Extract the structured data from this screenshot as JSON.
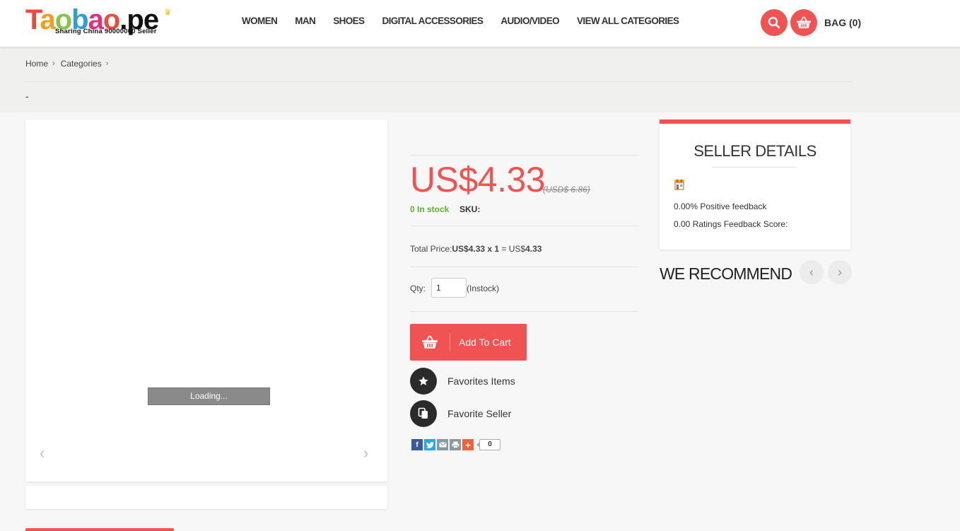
{
  "brand": {
    "logo_main": [
      "T",
      "a",
      "o",
      "b",
      "a",
      "o",
      ".pe"
    ],
    "logo_tagline": "Sharing China 90000000 Seller"
  },
  "nav": {
    "items": [
      "WOMEN",
      "MAN",
      "SHOES",
      "DIGITAL ACCESSORIES",
      "AUDIO/VIDEO",
      "VIEW ALL CATEGORIES"
    ]
  },
  "header": {
    "bag_label": "BAG (0)",
    "search_icon": "search-icon",
    "bag_icon": "basket-icon",
    "accent_color": "#f05352"
  },
  "breadcrumb": {
    "items": [
      "Home",
      "Categories"
    ],
    "separator": "›",
    "title": "-"
  },
  "gallery": {
    "loading_text": "Loading...",
    "prev_arrow": "‹",
    "next_arrow": "›"
  },
  "product": {
    "price": "US$4.33",
    "old_price": "(USD$ 6.86)",
    "stock": "0 In stock",
    "sku_label": "SKU:",
    "total_label": "Total Price:",
    "total_unit": "US$4.33 x 1",
    "total_equals": " = US$",
    "total_value": "4.33",
    "qty_label": "Qty:",
    "qty_value": "1",
    "instock_label": "(Instock)",
    "add_to_cart": "Add To Cart",
    "favorites_items": "Favorites Items",
    "favorite_seller": "Favorite Seller",
    "share_count": "0"
  },
  "seller": {
    "title": "SELLER DETAILS",
    "positive_feedback": "0.00% Positive feedback",
    "ratings": "0.00 Ratings Feedback Score:"
  },
  "recommend": {
    "title": "WE RECOMMEND",
    "prev_arrow": "‹",
    "next_arrow": "›"
  }
}
